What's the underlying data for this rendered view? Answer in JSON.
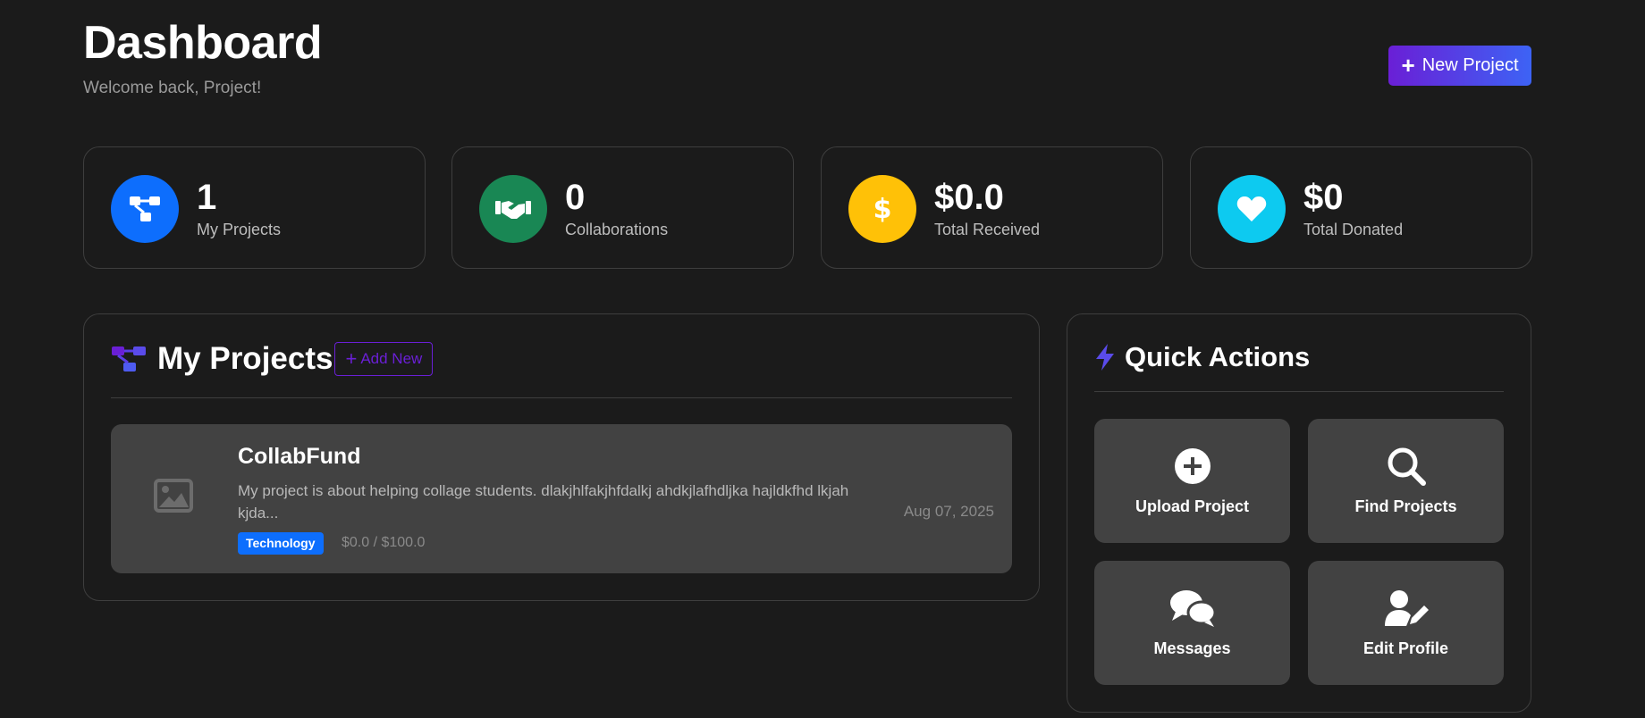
{
  "header": {
    "title": "Dashboard",
    "subtitle": "Welcome back, Project!",
    "new_project_label": "New Project"
  },
  "stats": [
    {
      "value": "1",
      "label": "My Projects",
      "icon": "project-diagram-icon",
      "color": "#0d6efd"
    },
    {
      "value": "0",
      "label": "Collaborations",
      "icon": "handshake-icon",
      "color": "#198754"
    },
    {
      "value": "$0.0",
      "label": "Total Received",
      "icon": "dollar-icon",
      "color": "#ffc107"
    },
    {
      "value": "$0",
      "label": "Total Donated",
      "icon": "heart-icon",
      "color": "#0dcaf0"
    }
  ],
  "my_projects": {
    "title": "My Projects",
    "add_new_label": "Add New",
    "items": [
      {
        "name": "CollabFund",
        "description": "My project is about helping collage students. dlakjhlfakjhfdalkj ahdkjlafhdljka hajldkfhd lkjah kjda...",
        "tag": "Technology",
        "funding": "$0.0 / $100.0",
        "date": "Aug 07, 2025"
      }
    ]
  },
  "quick_actions": {
    "title": "Quick Actions",
    "items": [
      {
        "label": "Upload Project",
        "icon": "plus-circle-icon"
      },
      {
        "label": "Find Projects",
        "icon": "search-icon"
      },
      {
        "label": "Messages",
        "icon": "comments-icon"
      },
      {
        "label": "Edit Profile",
        "icon": "user-edit-icon"
      }
    ]
  },
  "colors": {
    "background": "#1b1b1b",
    "card": "#424242",
    "accent_purple": "#6a1fd6",
    "accent_blue": "#3d63f5"
  }
}
